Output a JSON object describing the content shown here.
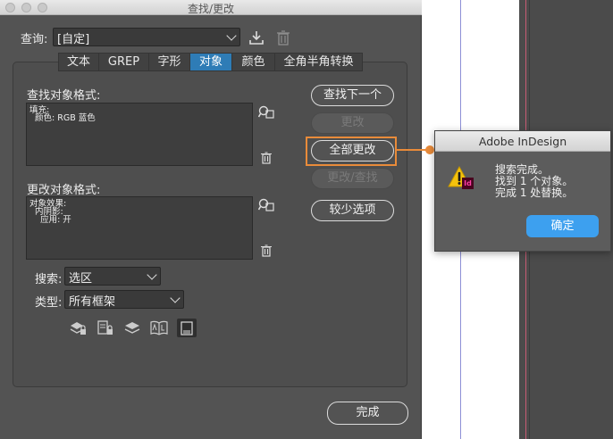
{
  "window": {
    "title": "查找/更改"
  },
  "query": {
    "label": "查询:",
    "value": "[自定]"
  },
  "tabs": [
    {
      "label": "文本",
      "active": false
    },
    {
      "label": "GREP",
      "active": false
    },
    {
      "label": "字形",
      "active": false
    },
    {
      "label": "对象",
      "active": true
    },
    {
      "label": "颜色",
      "active": false
    },
    {
      "label": "全角半角转换",
      "active": false
    }
  ],
  "find_format": {
    "label": "查找对象格式:",
    "lines": [
      "填充:",
      "  颜色: RGB 蓝色"
    ]
  },
  "change_format": {
    "label": "更改对象格式:",
    "lines": [
      "对象效果:",
      "  内阴影:",
      "    应用: 开"
    ]
  },
  "buttons": {
    "find_next": "查找下一个",
    "change": "更改",
    "change_all": "全部更改",
    "change_find": "更改/查找",
    "fewer_options": "较少选项",
    "done": "完成"
  },
  "search": {
    "label": "搜索:",
    "value": "选区"
  },
  "type": {
    "label": "类型:",
    "value": "所有框架"
  },
  "alert": {
    "title": "Adobe InDesign",
    "badge": "Id",
    "messages": [
      "搜索完成。",
      "找到 1 个对象。",
      "完成 1 处替换。"
    ],
    "ok_label": "确定"
  },
  "colors": {
    "accent": "#e98b3a",
    "active_tab": "#2e7cb6",
    "ok_button": "#3da0ef"
  },
  "icons": [
    "save-query-icon",
    "delete-query-icon",
    "specify-find-format-icon",
    "clear-find-format-icon",
    "specify-change-format-icon",
    "clear-change-format-icon",
    "include-locked-layers-icon",
    "include-locked-objects-icon",
    "include-hidden-layers-icon",
    "include-master-pages-icon",
    "include-footnotes-icon",
    "warning-icon"
  ]
}
